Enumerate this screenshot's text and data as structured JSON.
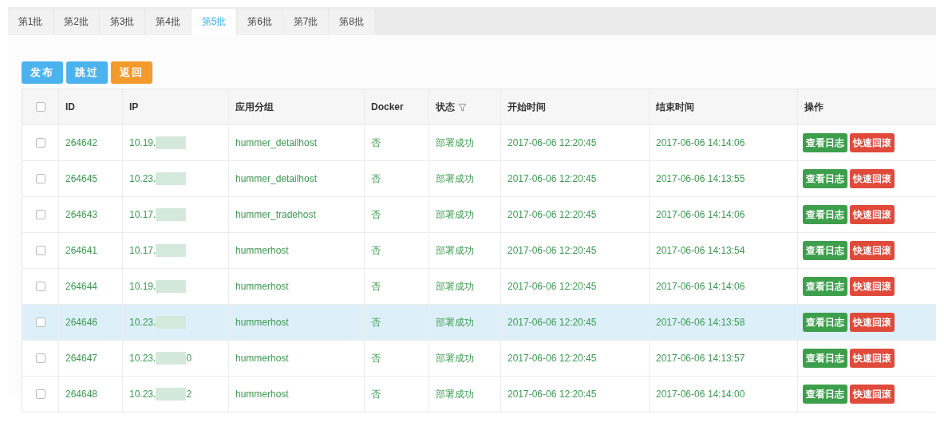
{
  "tabs": [
    {
      "label": "第1批",
      "selected": false
    },
    {
      "label": "第2批",
      "selected": false
    },
    {
      "label": "第3批",
      "selected": false
    },
    {
      "label": "第4批",
      "selected": false
    },
    {
      "label": "第5批",
      "selected": true
    },
    {
      "label": "第6批",
      "selected": false
    },
    {
      "label": "第7批",
      "selected": false
    },
    {
      "label": "第8批",
      "selected": false
    }
  ],
  "actions": [
    {
      "label": "发布",
      "kind": "primary"
    },
    {
      "label": "跳过",
      "kind": "primary"
    },
    {
      "label": "返回",
      "kind": "warning"
    }
  ],
  "table": {
    "select_all": {
      "checked": false
    },
    "columns": [
      "ID",
      "IP",
      "应用分组",
      "Docker",
      "状态",
      "开始时间",
      "结束时间",
      "操作"
    ],
    "rows": [
      {
        "checked": false,
        "highlighted": false,
        "id": "264642",
        "ip": "10.19.",
        "ip_tail": "",
        "group": "hummer_detailhost",
        "docker": "否",
        "status": "部署成功",
        "start": "2017-06-06 12:20:45",
        "end": "2017-06-06 14:14:06",
        "buttons": [
          "查看日志",
          "快速回滚"
        ]
      },
      {
        "checked": false,
        "highlighted": false,
        "id": "264645",
        "ip": "10.23.",
        "ip_tail": "",
        "group": "hummer_detailhost",
        "docker": "否",
        "status": "部署成功",
        "start": "2017-06-06 12:20:45",
        "end": "2017-06-06 14:13:55",
        "buttons": [
          "查看日志",
          "快速回滚"
        ]
      },
      {
        "checked": false,
        "highlighted": false,
        "id": "264643",
        "ip": "10.17.",
        "ip_tail": "",
        "group": "hummer_tradehost",
        "docker": "否",
        "status": "部署成功",
        "start": "2017-06-06 12:20:45",
        "end": "2017-06-06 14:14:06",
        "buttons": [
          "查看日志",
          "快速回滚"
        ]
      },
      {
        "checked": false,
        "highlighted": false,
        "id": "264641",
        "ip": "10.17.",
        "ip_tail": "",
        "group": "hummerhost",
        "docker": "否",
        "status": "部署成功",
        "start": "2017-06-06 12:20:45",
        "end": "2017-06-06 14:13:54",
        "buttons": [
          "查看日志",
          "快速回滚"
        ]
      },
      {
        "checked": false,
        "highlighted": false,
        "id": "264644",
        "ip": "10.19.",
        "ip_tail": "",
        "group": "hummerhost",
        "docker": "否",
        "status": "部署成功",
        "start": "2017-06-06 12:20:45",
        "end": "2017-06-06 14:14:06",
        "buttons": [
          "查看日志",
          "快速回滚"
        ]
      },
      {
        "checked": false,
        "highlighted": true,
        "id": "264646",
        "ip": "10.23.",
        "ip_tail": "",
        "group": "hummerhost",
        "docker": "否",
        "status": "部署成功",
        "start": "2017-06-06 12:20:45",
        "end": "2017-06-06 14:13:58",
        "buttons": [
          "查看日志",
          "快速回滚"
        ]
      },
      {
        "checked": false,
        "highlighted": false,
        "id": "264647",
        "ip": "10.23.",
        "ip_tail": "0",
        "group": "hummerhost",
        "docker": "否",
        "status": "部署成功",
        "start": "2017-06-06 12:20:45",
        "end": "2017-06-06 14:13:57",
        "buttons": [
          "查看日志",
          "快速回滚"
        ]
      },
      {
        "checked": false,
        "highlighted": false,
        "id": "264648",
        "ip": "10.23.",
        "ip_tail": "2",
        "group": "hummerhost",
        "docker": "否",
        "status": "部署成功",
        "start": "2017-06-06 12:20:45",
        "end": "2017-06-06 14:14:00",
        "buttons": [
          "查看日志",
          "快速回滚"
        ]
      }
    ]
  }
}
